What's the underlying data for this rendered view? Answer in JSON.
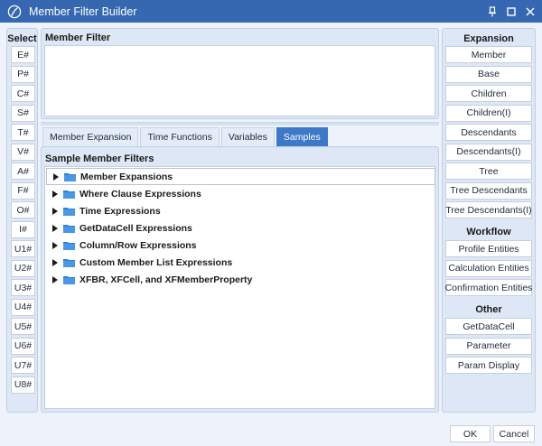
{
  "window": {
    "title": "Member Filter Builder",
    "logo_icon": "onestream-logo-icon",
    "controls": [
      "pin-icon",
      "maximize-icon",
      "close-icon"
    ]
  },
  "select": {
    "header": "Select",
    "buttons": [
      "E#",
      "P#",
      "C#",
      "S#",
      "T#",
      "V#",
      "A#",
      "F#",
      "O#",
      "I#",
      "U1#",
      "U2#",
      "U3#",
      "U4#",
      "U5#",
      "U6#",
      "U7#",
      "U8#"
    ]
  },
  "member_filter": {
    "header": "Member Filter",
    "value": ""
  },
  "tabs": [
    "Member Expansion",
    "Time Functions",
    "Variables",
    "Samples"
  ],
  "active_tab": "Samples",
  "samples": {
    "header": "Sample Member Filters",
    "items": [
      "Member Expansions",
      "Where Clause Expressions",
      "Time Expressions",
      "GetDataCell Expressions",
      "Column/Row Expressions",
      "Custom Member List Expressions",
      "XFBR, XFCell, and XFMemberProperty"
    ]
  },
  "expansion": {
    "header": "Expansion",
    "buttons": [
      "Member",
      "Base",
      "Children",
      "Children(I)",
      "Descendants",
      "Descendants(I)",
      "Tree",
      "Tree Descendants",
      "Tree Descendants(I)"
    ]
  },
  "workflow": {
    "header": "Workflow",
    "buttons": [
      "Profile Entities",
      "Calculation Entities",
      "Confirmation Entities"
    ]
  },
  "other": {
    "header": "Other",
    "buttons": [
      "GetDataCell",
      "Parameter",
      "Param Display"
    ]
  },
  "footer": {
    "ok": "OK",
    "cancel": "Cancel"
  },
  "colors": {
    "titlebar": "#3568b0",
    "active_tab": "#3e78c8",
    "folder": "#2f7fd6",
    "panel": "#dde7f5",
    "background": "#eef3fb"
  }
}
